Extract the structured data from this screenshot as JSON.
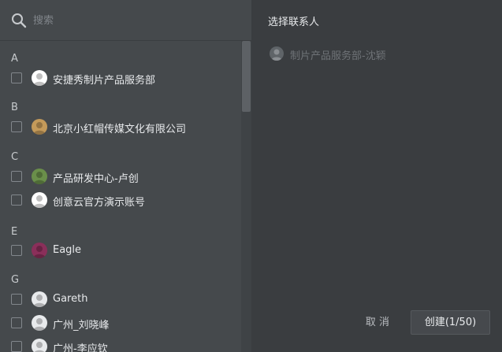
{
  "search": {
    "placeholder": "搜索"
  },
  "panel": {
    "title": "选择联系人"
  },
  "groups": [
    {
      "letter": "A",
      "contacts": [
        {
          "name": "安捷秀制片产品服务部",
          "avatar": "brand-logo-avatar",
          "color": "#ffffff",
          "checked": false
        }
      ]
    },
    {
      "letter": "B",
      "contacts": [
        {
          "name": "北京小红帽传媒文化有限公司",
          "avatar": "dog-avatar",
          "color": "#c49a5a",
          "checked": false
        }
      ]
    },
    {
      "letter": "C",
      "contacts": [
        {
          "name": "产品研发中心-卢创",
          "avatar": "landscape-avatar",
          "color": "#6a8f4a",
          "checked": false
        },
        {
          "name": "创意云官方演示账号",
          "avatar": "logo-avatar",
          "color": "#ffffff",
          "checked": false
        }
      ]
    },
    {
      "letter": "E",
      "contacts": [
        {
          "name": "Eagle",
          "avatar": "character-avatar",
          "color": "#8a2f5a",
          "checked": false
        }
      ]
    },
    {
      "letter": "G",
      "contacts": [
        {
          "name": "Gareth",
          "avatar": "person-avatar",
          "color": "#e8eaec",
          "checked": false
        },
        {
          "name": "广州_刘晓峰",
          "avatar": "person-avatar",
          "color": "#e8eaec",
          "checked": false
        },
        {
          "name": "广州-李应钦",
          "avatar": "person-avatar",
          "color": "#e8eaec",
          "checked": false
        }
      ]
    }
  ],
  "selected": [
    {
      "name": "制片产品服务部-沈颖",
      "avatar": "grey-avatar"
    }
  ],
  "actions": {
    "cancel_label": "取 消",
    "create_label": "创建(1/50)"
  },
  "colors": {
    "left_bg": "#45494c",
    "right_bg": "#3a3d40",
    "text": "#e8eaec",
    "muted": "#6e7276"
  }
}
